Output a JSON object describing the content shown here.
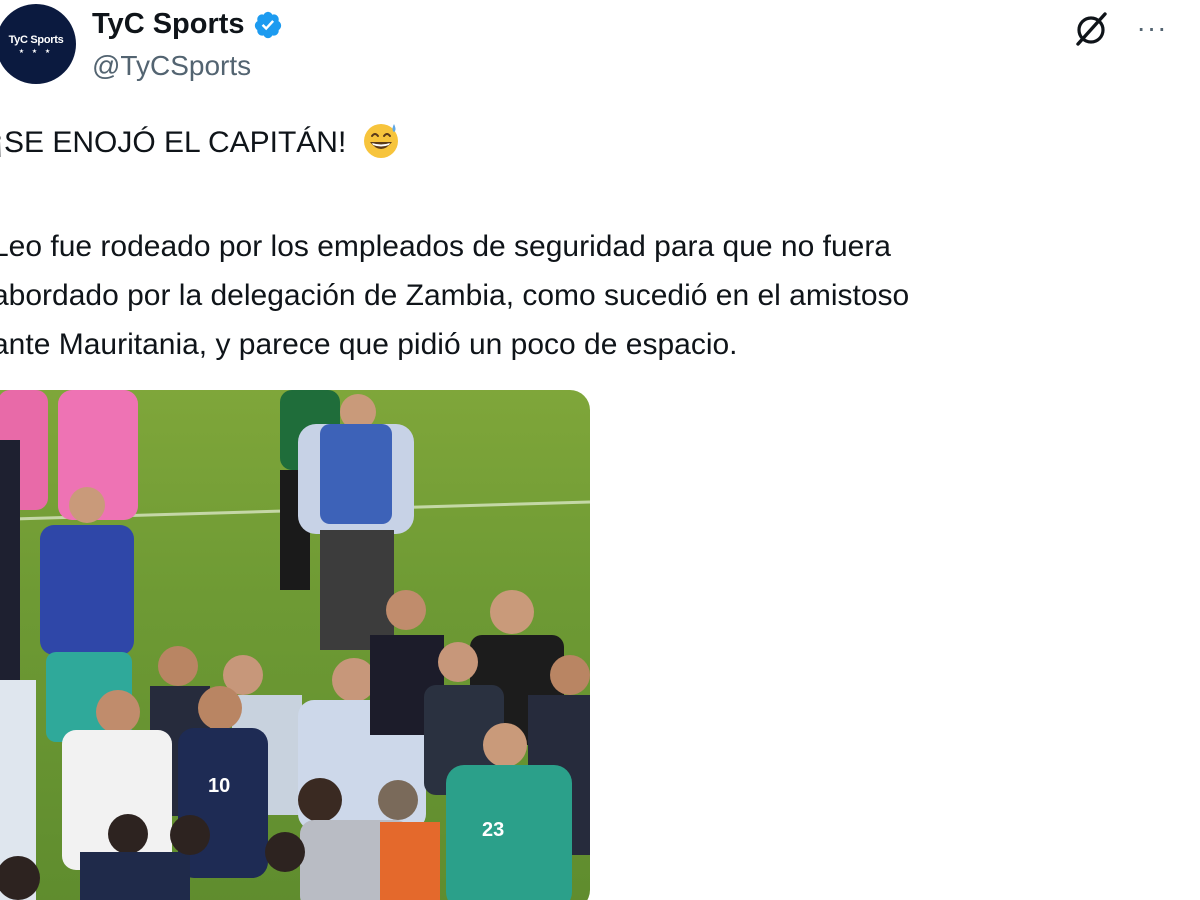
{
  "tweet": {
    "author": {
      "display_name": "TyC Sports",
      "handle": "@TyCSports",
      "avatar_text": "TyC Sports",
      "avatar_stars": "★ ★ ★",
      "verified": true
    },
    "header_icons": [
      "grok-icon",
      "more-options-icon"
    ],
    "more_label": "···",
    "headline": "¡SE ENOJÓ EL CAPITÁN!",
    "headline_emoji": "grinning-face-with-sweat",
    "body_lines": [
      "Leo fue rodeado por los empleados de seguridad para que no fuera",
      "abordado por la delegación de Zambia, como sucedió en el amistoso",
      "ante Mauritania, y parece que pidió un poco de espacio."
    ],
    "media": {
      "type": "photo",
      "jersey_numbers": [
        "10",
        "23"
      ]
    }
  },
  "colors": {
    "text": "#0f1419",
    "secondary_text": "#536471",
    "verified_badge": "#1d9bf0",
    "avatar_bg": "#0b1a3f",
    "pitch_green": "#6e9a34"
  }
}
